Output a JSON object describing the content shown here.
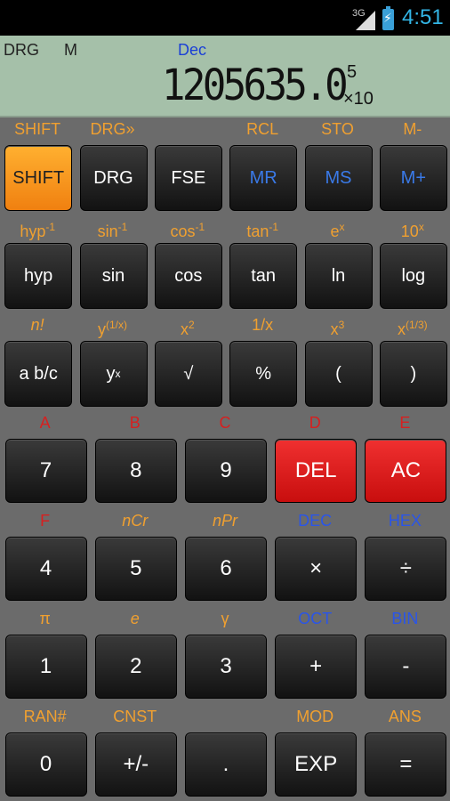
{
  "status": {
    "network": "3G",
    "time": "4:51"
  },
  "display": {
    "angle_mode": "DRG",
    "memory_flag": "M",
    "base_mode": "Dec",
    "main": "1205635.0",
    "exponent": "5",
    "x10": "×10"
  },
  "rows": [
    {
      "type": "small",
      "alts": [
        {
          "label": "SHIFT",
          "color": "orange"
        },
        {
          "label": "DRG»",
          "color": "orange"
        },
        {
          "label": "",
          "color": "orange"
        },
        {
          "label": "RCL",
          "color": "orange"
        },
        {
          "label": "STO",
          "color": "orange"
        },
        {
          "label": "M-",
          "color": "orange"
        }
      ],
      "keys": [
        {
          "label": "SHIFT",
          "style": "orange"
        },
        {
          "label": "DRG",
          "style": ""
        },
        {
          "label": "FSE",
          "style": ""
        },
        {
          "label": "MR",
          "style": "blue"
        },
        {
          "label": "MS",
          "style": "blue"
        },
        {
          "label": "M+",
          "style": "blue"
        }
      ]
    },
    {
      "type": "small",
      "alts": [
        {
          "label": "hyp",
          "sup": "-1",
          "color": "orange"
        },
        {
          "label": "sin",
          "sup": "-1",
          "color": "orange"
        },
        {
          "label": "cos",
          "sup": "-1",
          "color": "orange"
        },
        {
          "label": "tan",
          "sup": "-1",
          "color": "orange"
        },
        {
          "label": "e",
          "sup": "x",
          "color": "orange"
        },
        {
          "label": "10",
          "sup": "x",
          "color": "orange"
        }
      ],
      "keys": [
        {
          "label": "hyp",
          "style": ""
        },
        {
          "label": "sin",
          "style": ""
        },
        {
          "label": "cos",
          "style": ""
        },
        {
          "label": "tan",
          "style": ""
        },
        {
          "label": "ln",
          "style": ""
        },
        {
          "label": "log",
          "style": ""
        }
      ]
    },
    {
      "type": "small",
      "alts": [
        {
          "label": "n!",
          "color": "orange",
          "italic": true
        },
        {
          "label": "y",
          "sup": "(1/x)",
          "color": "orange"
        },
        {
          "label": "x",
          "sup": "2",
          "color": "orange"
        },
        {
          "label": "1/x",
          "color": "orange"
        },
        {
          "label": "x",
          "sup": "3",
          "color": "orange"
        },
        {
          "label": "x",
          "sup": "(1/3)",
          "color": "orange"
        }
      ],
      "keys": [
        {
          "label": "a b/c",
          "style": ""
        },
        {
          "label": "y",
          "sup": "x",
          "style": ""
        },
        {
          "label": "√",
          "style": ""
        },
        {
          "label": "%",
          "style": ""
        },
        {
          "label": "(",
          "style": ""
        },
        {
          "label": ")",
          "style": ""
        }
      ]
    },
    {
      "type": "big",
      "alts": [
        {
          "label": "A",
          "color": "red"
        },
        {
          "label": "B",
          "color": "red"
        },
        {
          "label": "C",
          "color": "red"
        },
        {
          "label": "D",
          "color": "red"
        },
        {
          "label": "E",
          "color": "red"
        }
      ],
      "keys": [
        {
          "label": "7",
          "style": ""
        },
        {
          "label": "8",
          "style": ""
        },
        {
          "label": "9",
          "style": ""
        },
        {
          "label": "DEL",
          "style": "red"
        },
        {
          "label": "AC",
          "style": "red"
        }
      ]
    },
    {
      "type": "big",
      "alts": [
        {
          "label": "F",
          "color": "red"
        },
        {
          "label": "nCr",
          "color": "orange",
          "italic": true
        },
        {
          "label": "nPr",
          "color": "orange",
          "italic": true
        },
        {
          "label": "DEC",
          "color": "blue"
        },
        {
          "label": "HEX",
          "color": "blue"
        }
      ],
      "keys": [
        {
          "label": "4",
          "style": ""
        },
        {
          "label": "5",
          "style": ""
        },
        {
          "label": "6",
          "style": ""
        },
        {
          "label": "×",
          "style": ""
        },
        {
          "label": "÷",
          "style": ""
        }
      ]
    },
    {
      "type": "big",
      "alts": [
        {
          "label": "π",
          "color": "orange"
        },
        {
          "label": "e",
          "color": "orange",
          "italic": true
        },
        {
          "label": "γ",
          "color": "orange"
        },
        {
          "label": "OCT",
          "color": "blue"
        },
        {
          "label": "BIN",
          "color": "blue"
        }
      ],
      "keys": [
        {
          "label": "1",
          "style": ""
        },
        {
          "label": "2",
          "style": ""
        },
        {
          "label": "3",
          "style": ""
        },
        {
          "label": "+",
          "style": ""
        },
        {
          "label": "-",
          "style": ""
        }
      ]
    },
    {
      "type": "big",
      "alts": [
        {
          "label": "RAN#",
          "color": "orange"
        },
        {
          "label": "CNST",
          "color": "orange"
        },
        {
          "label": "",
          "color": "orange"
        },
        {
          "label": "MOD",
          "color": "orange"
        },
        {
          "label": "ANS",
          "color": "orange"
        }
      ],
      "keys": [
        {
          "label": "0",
          "style": ""
        },
        {
          "label": "+/-",
          "style": ""
        },
        {
          "label": ".",
          "style": ""
        },
        {
          "label": "EXP",
          "style": ""
        },
        {
          "label": "=",
          "style": ""
        }
      ]
    }
  ]
}
